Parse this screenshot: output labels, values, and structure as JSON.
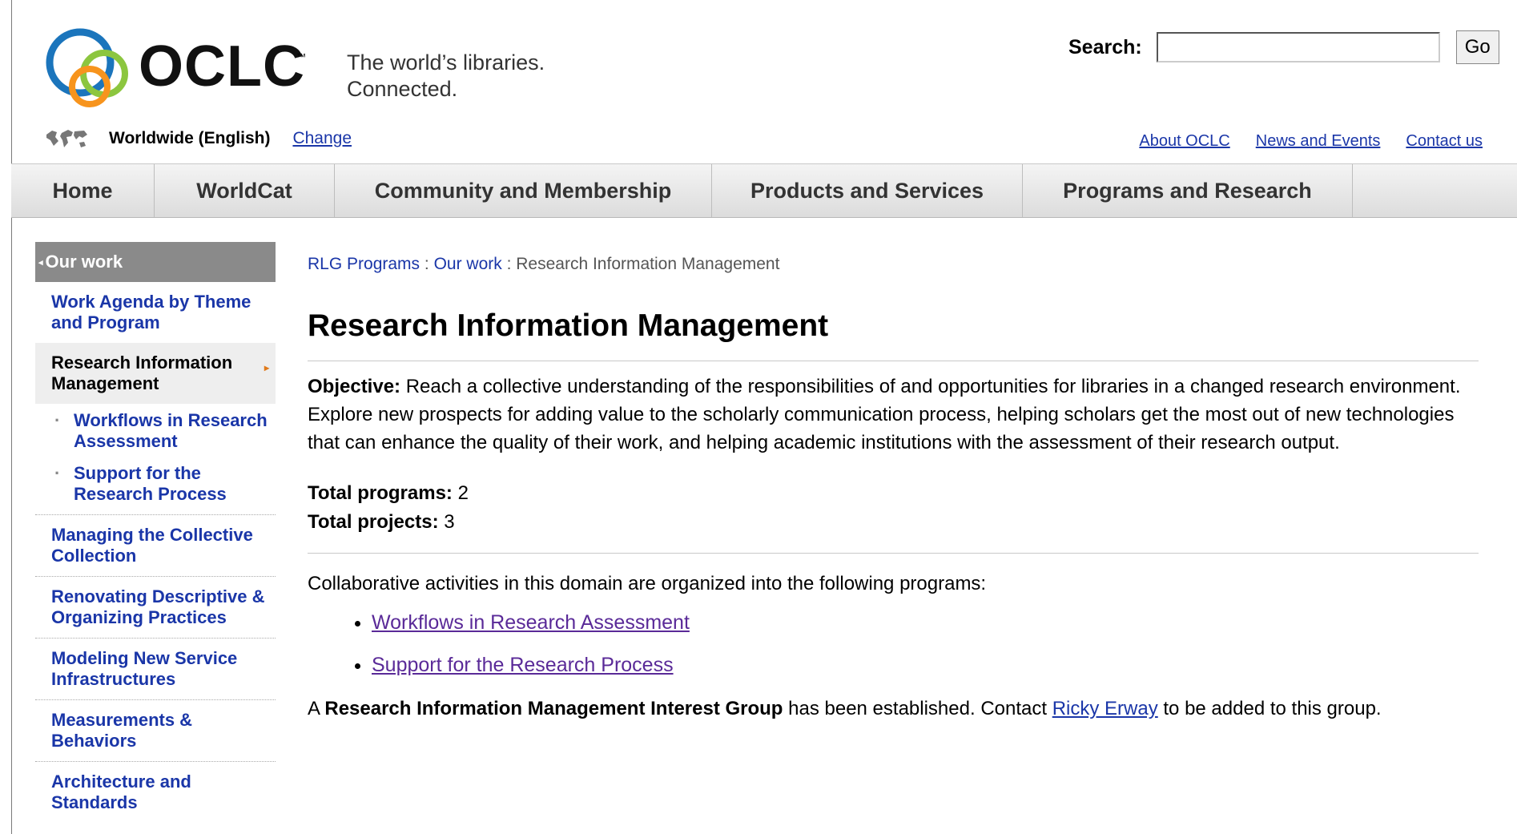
{
  "header": {
    "logo_text": "OCLC",
    "logo_tm": "™",
    "tagline_line1": "The world’s libraries.",
    "tagline_line2": "Connected.",
    "search_label": "Search:",
    "search_value": "",
    "go_label": "Go",
    "region_name": "Worldwide (English)",
    "change_label": "Change",
    "utility_links": [
      "About OCLC",
      "News and Events",
      "Contact us"
    ]
  },
  "nav": {
    "tabs": [
      "Home",
      "WorldCat",
      "Community and Membership",
      "Products and Services",
      "Programs and Research"
    ]
  },
  "sidebar": {
    "heading": "Our work",
    "items": [
      "Work Agenda by Theme and Program",
      "Research Information Management",
      "Managing the Collective Collection",
      "Renovating Descriptive & Organizing Practices",
      "Modeling New Service Infrastructures",
      "Measurements & Behaviors",
      "Architecture and Standards"
    ],
    "subitems": [
      "Workflows in Research Assessment",
      "Support for the Research Process"
    ]
  },
  "main": {
    "breadcrumb": [
      "RLG Programs",
      "Our work",
      "Research Information Management"
    ],
    "breadcrumb_sep": " : ",
    "title": "Research Information Management",
    "objective_label": "Objective:",
    "objective_text": " Reach a collective understanding of the responsibilities of and opportunities for libraries in a changed research environment. Explore new prospects for adding value to the scholarly communication process, helping scholars get the most out of new technologies that can enhance the quality of their work, and helping academic institutions with the assessment of their research output.",
    "total_programs_label": "Total programs:",
    "total_programs_value": "2",
    "total_projects_label": "Total projects:",
    "total_projects_value": "3",
    "intro": "Collaborative activities in this domain are organized into the following programs:",
    "programs": [
      "Workflows in Research Assessment",
      "Support for the Research Process"
    ],
    "group_prefix": "A ",
    "group_name": "Research Information Management Interest Group",
    "group_middle": " has been established. Contact ",
    "group_contact": "Ricky Erway",
    "group_suffix": " to be added to this group."
  },
  "colors": {
    "link": "#1a36a8",
    "visited_link": "#5a2a98",
    "sidebar_heading_bg": "#8a8a8a",
    "logo_blue": "#1b75bc",
    "logo_green": "#8cc63f",
    "logo_orange": "#f7941d"
  }
}
